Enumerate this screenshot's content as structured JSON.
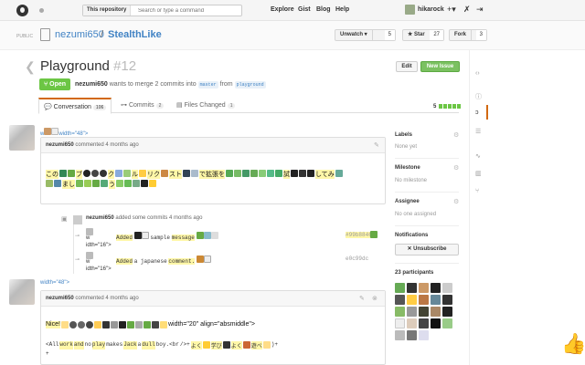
{
  "header": {
    "scope": "This repository",
    "search_placeholder": "Search or type a command",
    "nav": [
      "Explore",
      "Gist",
      "Blog",
      "Help"
    ],
    "username": "hikarock",
    "icons": [
      "plus-icon",
      "wrench-icon",
      "signout-icon"
    ]
  },
  "repo": {
    "visibility": "PUBLIC",
    "owner": "nezumi650",
    "slash": "/",
    "name": "StealthLike",
    "unwatch_label": "Unwatch ▾",
    "unwatch_count": "5",
    "star_label": "★ Star",
    "star_count": "27",
    "fork_label": "Fork",
    "fork_count": "3"
  },
  "issue": {
    "title": "Playground",
    "number": "#12",
    "edit_label": "Edit",
    "new_issue_label": "New Issue",
    "state": "Open",
    "author": "nezumi650",
    "merge_text": "wants to merge 2 commits into",
    "base_branch": "master",
    "from_text": "from",
    "head_branch": "playground"
  },
  "tabs": [
    {
      "label": "Conversation",
      "count": "106"
    },
    {
      "label": "Commits",
      "count": "2"
    },
    {
      "label": "Files Changed",
      "count": "1"
    }
  ],
  "diffstat": "5",
  "comment1": {
    "raw_above": "width=\"48\">",
    "raw_prefix": "w",
    "author": "nezumi650",
    "action": "commented 4 months ago",
    "body_start": "この",
    "body_words": [
      "ブ",
      "ク",
      "ル",
      "リク",
      "スト",
      "で拡張を",
      "試",
      "してみ",
      "まし",
      "う"
    ]
  },
  "commits": {
    "author": "nezumi650",
    "action": "added some commits 4 months ago",
    "rows": [
      {
        "frag": "w",
        "frag2": "idth=\"16\">",
        "added": "Added",
        "sample": "sample",
        "message": "message",
        "sha": "#99b8846"
      },
      {
        "frag": "w",
        "frag2": "idth=\"16\">",
        "added": "Added",
        "sample": "a japanese",
        "message": "comment.",
        "sha": "e0c99dc"
      }
    ]
  },
  "comment2": {
    "raw_above": "width=\"48\">",
    "author": "nezumi650",
    "action": "commented 4 months ago",
    "line1_start": "Nice!",
    "line1_tail": "width=\"20\" align=\"absmiddle\">",
    "line2_words": [
      "<All",
      "work",
      "and",
      "no",
      "play",
      "makes",
      "Jack",
      "a",
      "dull",
      "boy.<br",
      "/>+",
      "よく",
      "学び",
      "よく",
      "遊べ",
      "",
      ")+"
    ],
    "line3": "+"
  },
  "sidebar": {
    "labels_title": "Labels",
    "labels_value": "None yet",
    "milestone_title": "Milestone",
    "milestone_value": "No milestone",
    "assignee_title": "Assignee",
    "assignee_value": "No one assigned",
    "notifications_title": "Notifications",
    "unsubscribe_label": "✕ Unsubscribe",
    "participants_title": "23 participants"
  },
  "colors": {
    "accent": "#4183c4",
    "open_green": "#6cc644",
    "tab_orange": "#d26911",
    "highlight": "#fff7a8"
  }
}
